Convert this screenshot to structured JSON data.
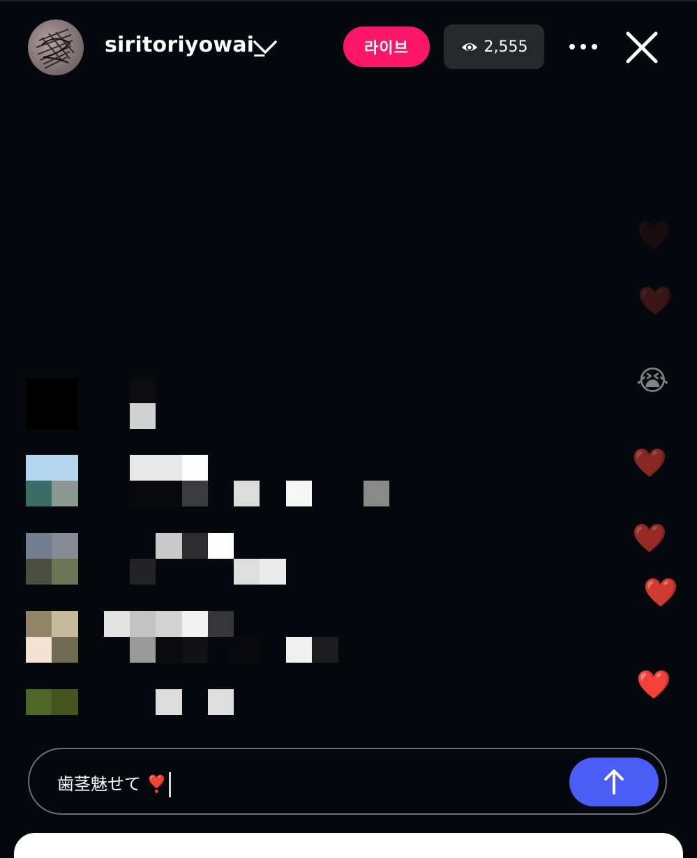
{
  "header": {
    "username": "siritoriyowai_",
    "live_label": "라이브",
    "viewer_count": "2,555"
  },
  "reactions": [
    "❤️",
    "❤️",
    "😭",
    "❤️",
    "❤️",
    "❤️",
    "❤️"
  ],
  "composer": {
    "text": "歯茎魅せて",
    "emoji": "❣️"
  },
  "colors": {
    "live_badge": "#fb1765",
    "send_button": "#4a5df5",
    "background": "#05080c"
  }
}
